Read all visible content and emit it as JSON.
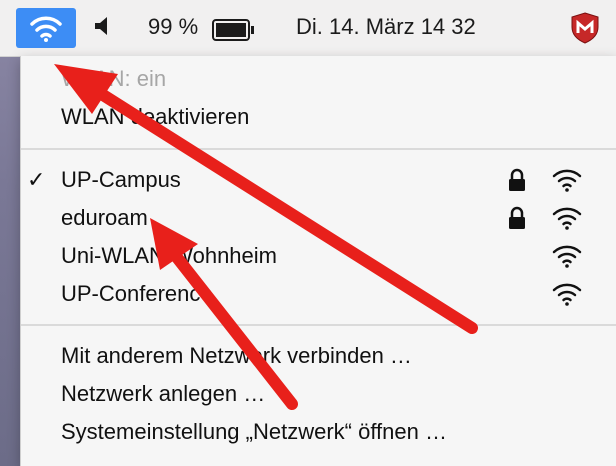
{
  "menubar": {
    "battery_percent": "99 %",
    "datetime": "Di. 14. März  14 32",
    "icons": [
      "wifi-icon",
      "speaker-icon",
      "battery-icon",
      "mcafee-shield-icon"
    ]
  },
  "menu": {
    "status": "WLAN: ein",
    "toggle": "WLAN deaktivieren",
    "networks": [
      {
        "name": "UP-Campus",
        "checked": true,
        "locked": true
      },
      {
        "name": "eduroam",
        "checked": false,
        "locked": true
      },
      {
        "name": "Uni-WLAN-Wohnheim",
        "checked": false,
        "locked": false
      },
      {
        "name": "UP-Conference",
        "checked": false,
        "locked": false
      }
    ],
    "other_network": "Mit anderem Netzwerk verbinden …",
    "create_network": "Netzwerk anlegen …",
    "preferences": "Systemeinstellung „Netzwerk“ öffnen …",
    "checkmark": "✓"
  },
  "colors": {
    "accent": "#3d8df5",
    "annotation_arrow": "#e8201b"
  }
}
